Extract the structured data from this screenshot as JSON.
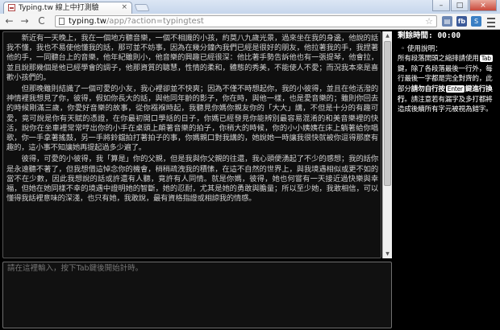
{
  "browser": {
    "tab_title": "Typing.tw 線上中打測驗",
    "tab_close": "×",
    "window_buttons": [
      "–",
      "□",
      "×"
    ],
    "back": "←",
    "forward": "→",
    "reload": "C",
    "url_domain": "typing.tw",
    "url_path": "/app/?action=typingtest",
    "star": "☆",
    "ext_1": "▤",
    "ext_2": "fb",
    "ext_3": "S"
  },
  "story": {
    "paragraphs": [
      "新近有一天晚上，我在一個地方聽音樂，一個不相識的小孩，約莫八九歲光景，過來坐在我的身邊，他說的話我不懂，我也不易使他懂我的話，那可並不妨事，因為在幾分鐘內我們已經是很好的朋友，他拉著我的手，我捏著他的手，一同聽台上的音樂，他年紀雖則小，他音樂的興趣已經很深：他比著手勢告訴他也有一張提琴，他會拉，並且說那幾個是他已經學會的調子，他那資質的聰慧，性情的柔和，體態的秀美，不能使人不愛；而況我本來是喜歡小孩們的。",
      "但那晚雖則結識了一個可愛的小友，我心裡卻並不快爽；因為不僅不時想起你，我的小彼得，並且在他活潑的神情裡我想見了你，彼得，假如你長大的話，與他同年齡的影子，你在時，與他一樣，也是愛音樂的；雖則你回去的時候剛滿三歲，你愛好音樂的故事，從你襁褓時起，我聽見你媽你親友你的「大大」講，不但是十分的有趣可愛，竟可說是你有天賦的憑證，在你最初開口學話的日子，你媽已經發見你能辨別最容易混淆的和美音樂裡的快活，說你在坐車裡常常哼出你的小手在桌頭上顛著音樂的拍子，你稍大的時候，你的小小姨姨在床上躺著給你唱歌，你一手拿著搖鼓，另一手將鈴鐺拍打著拍子的事，你媽親口對我講的，她說她一時讓我很快就被你逗得那麼有趣的，這小事不知讓她再提起過多少遍了。",
      "彼得，可愛的小彼得，我「算是」你的父親，但是我與你父親的往還，我心頭便湧起了不少的感想；我的話你是永遠聽不著了，但我想借這悼念你的機會，稍稍疏洩我的積愫，在這不自然的世界上，與我境遇相似或更不如的當不在少數，因此我想說的話或許還有人聽，竟許有人同情。就是你媽，彼得，她也何嘗有一天接近過快樂與幸福，但她在她同樣不幸的境遇中證明她的智斷，她的忍耐，尤其是她的勇敢與膽量；所以至少她，我敢相信，可以懂得我話裡意味的深淺，也只有她，我敢說，最有資格指證或相諒我的情感。"
    ]
  },
  "typing_area": {
    "placeholder": "請在這裡輸入，按下Tab鍵後開始計時。"
  },
  "side_panel": {
    "timer": "剩餘時間: 00:00",
    "instructions_title": "使用說明：",
    "instr_1": "所有段落開頭之縮排請使用",
    "key_tab": "Tab",
    "instr_2": "鍵，除了各段落最後一行外，每行最後一字都是完全對齊的，此部分",
    "instr_3_bold": "請勿自行按",
    "key_enter": "Enter",
    "instr_4_bold": "鍵進行換行",
    "instr_5": "。請注意若有漏字及多打都將造成後續所有字元被視為錯字。"
  }
}
